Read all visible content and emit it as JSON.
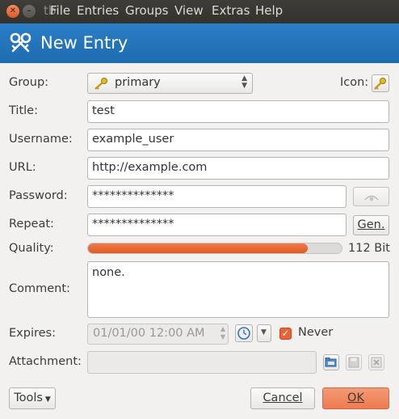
{
  "menubar": {
    "app_name": "tb",
    "items": [
      "File",
      "Entries",
      "Groups",
      "View",
      "Extras",
      "Help"
    ]
  },
  "header": {
    "title": "New Entry",
    "icon": "keys-icon"
  },
  "form": {
    "group_label": "Group:",
    "group_value": "primary",
    "icon_label": "Icon:",
    "title_label": "Title:",
    "title_value": "test",
    "username_label": "Username:",
    "username_value": "example_user",
    "url_label": "URL:",
    "url_value": "http://example.com",
    "password_label": "Password:",
    "password_value": "**************",
    "repeat_label": "Repeat:",
    "repeat_value": "**************",
    "gen_label": "Gen.",
    "quality_label": "Quality:",
    "quality_text": "112 Bit",
    "quality_fraction": 0.865,
    "comment_label": "Comment:",
    "comment_value": "none.",
    "expires_label": "Expires:",
    "expires_value": "01/01/00 12:00 AM",
    "never_label": "Never",
    "never_checked": true,
    "attachment_label": "Attachment:"
  },
  "footer": {
    "tools_label": "Tools",
    "cancel_label": "Cancel",
    "ok_label": "OK"
  },
  "colors": {
    "header_bg": "#2274ba",
    "accent": "#ee7a4e",
    "menubar_bg": "#3a3935"
  }
}
